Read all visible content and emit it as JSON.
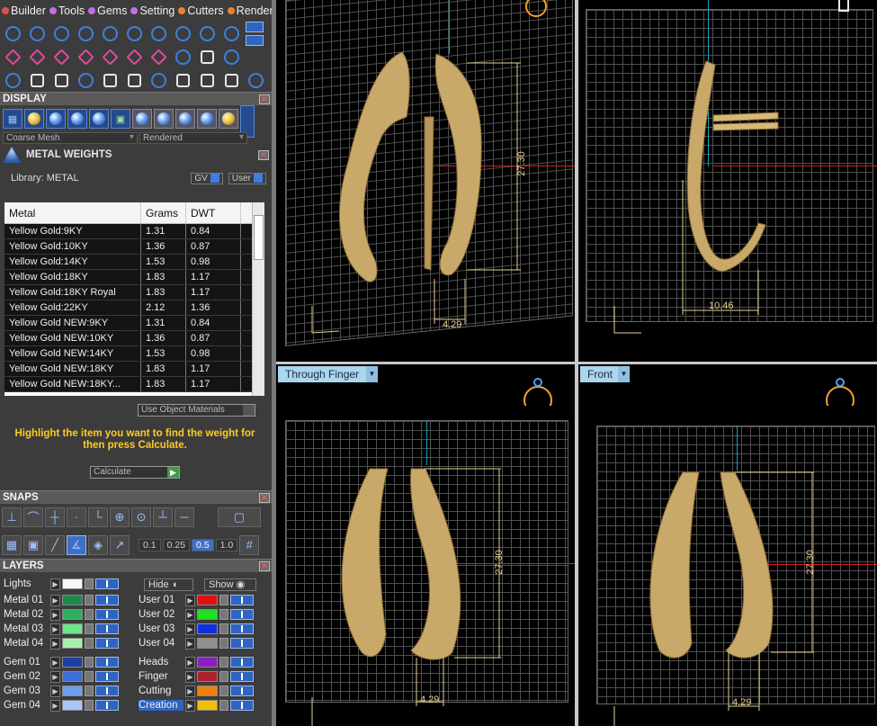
{
  "menu": [
    {
      "label": "Builder",
      "color": "#e05050"
    },
    {
      "label": "Tools",
      "color": "#c070e0"
    },
    {
      "label": "Gems",
      "color": "#c070e0"
    },
    {
      "label": "Setting",
      "color": "#c070e0"
    },
    {
      "label": "Cutters",
      "color": "#f08030"
    },
    {
      "label": "Render",
      "color": "#f08030"
    }
  ],
  "display": {
    "title": "DISPLAY",
    "mesh_mode": "Coarse Mesh",
    "render_mode": "Rendered"
  },
  "metal_weights": {
    "title": "METAL WEIGHTS",
    "library": "Library: METAL",
    "gv_label": "GV",
    "user_label": "User",
    "columns": [
      "Metal",
      "Grams",
      "DWT"
    ],
    "rows": [
      [
        "Yellow Gold:9KY",
        "1.31",
        "0.84"
      ],
      [
        "Yellow Gold:10KY",
        "1.36",
        "0.87"
      ],
      [
        "Yellow Gold:14KY",
        "1.53",
        "0.98"
      ],
      [
        "Yellow Gold:18KY",
        "1.83",
        "1.17"
      ],
      [
        "Yellow Gold:18KY Royal",
        "1.83",
        "1.17"
      ],
      [
        "Yellow Gold:22KY",
        "2.12",
        "1.36"
      ],
      [
        "Yellow Gold NEW:9KY",
        "1.31",
        "0.84"
      ],
      [
        "Yellow Gold NEW:10KY",
        "1.36",
        "0.87"
      ],
      [
        "Yellow Gold NEW:14KY",
        "1.53",
        "0.98"
      ],
      [
        "Yellow Gold NEW:18KY",
        "1.83",
        "1.17"
      ],
      [
        "Yellow Gold NEW:18KY...",
        "1.83",
        "1.17"
      ]
    ],
    "use_object_materials": "Use Object Materials",
    "hint": "Highlight the item you want to find the weight for then press Calculate.",
    "calculate": "Calculate"
  },
  "snaps": {
    "title": "SNAPS",
    "values": [
      "0.1",
      "0.25",
      "0.5",
      "1.0"
    ],
    "active_value": "0.5"
  },
  "layers": {
    "title": "LAYERS",
    "lights": "Lights",
    "hide": "Hide",
    "show": "Show",
    "left": [
      {
        "name": "Metal 01",
        "color": "#1e8a4a"
      },
      {
        "name": "Metal 02",
        "color": "#2fb060"
      },
      {
        "name": "Metal 03",
        "color": "#6ee68a"
      },
      {
        "name": "Metal 04",
        "color": "#a8f0b0"
      },
      {
        "name": "Gem 01",
        "color": "#1a3fa0"
      },
      {
        "name": "Gem 02",
        "color": "#3b6ed8"
      },
      {
        "name": "Gem 03",
        "color": "#6ea0f0"
      },
      {
        "name": "Gem 04",
        "color": "#a8c8f8"
      }
    ],
    "right": [
      {
        "name": "User 01",
        "color": "#e01010"
      },
      {
        "name": "User 02",
        "color": "#20e020"
      },
      {
        "name": "User 03",
        "color": "#1030e0"
      },
      {
        "name": "User 04",
        "color": "#909090"
      },
      {
        "name": "Heads",
        "color": "#8a20c0"
      },
      {
        "name": "Finger",
        "color": "#b02030"
      },
      {
        "name": "Cutting",
        "color": "#f08010"
      },
      {
        "name": "Creation",
        "color": "#f0c000"
      }
    ]
  },
  "viewports": [
    {
      "label": "",
      "dims": [
        "27.30",
        "4.29"
      ]
    },
    {
      "label": "",
      "dims": [
        "10.46"
      ]
    },
    {
      "label": "Through Finger",
      "dims": [
        "27.30",
        "4.29"
      ]
    },
    {
      "label": "Front",
      "dims": [
        "27.30",
        "4.29"
      ]
    }
  ],
  "colors": {
    "gold": "#c9a96a",
    "gold_dark": "#8a6a38",
    "axis_red": "#cc2020",
    "axis_cyan": "#1aa0b8",
    "dim": "#e8d090"
  }
}
